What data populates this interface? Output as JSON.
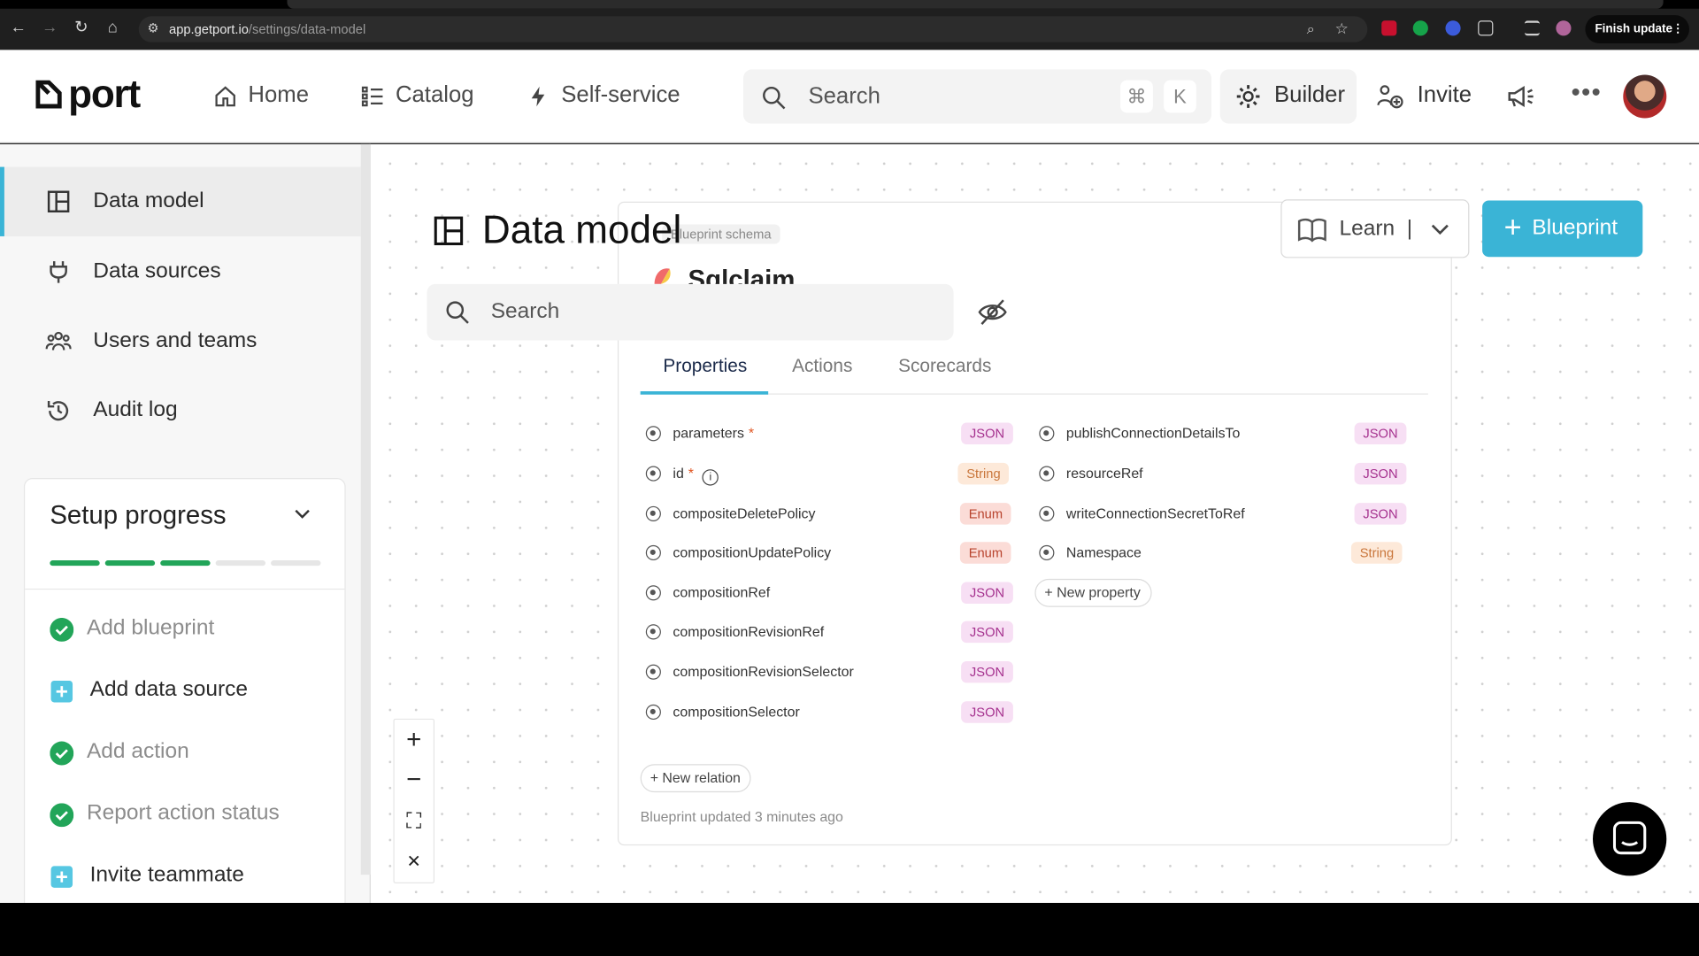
{
  "browser": {
    "url_host": "app.getport.io",
    "url_path": "/settings/data-model",
    "finish_update_label": "Finish update"
  },
  "header": {
    "logo_text": "port",
    "nav": [
      {
        "label": "Home",
        "icon": "home-icon"
      },
      {
        "label": "Catalog",
        "icon": "catalog-icon"
      },
      {
        "label": "Self-service",
        "icon": "lightning-icon"
      }
    ],
    "search_placeholder": "Search",
    "shortcut_keys": [
      "⌘",
      "K"
    ],
    "builder_label": "Builder",
    "invite_label": "Invite"
  },
  "sidebar": {
    "items": [
      {
        "label": "Data model",
        "icon": "data-model-icon",
        "active": true
      },
      {
        "label": "Data sources",
        "icon": "plug-icon",
        "active": false
      },
      {
        "label": "Users and teams",
        "icon": "users-icon",
        "active": false
      },
      {
        "label": "Audit log",
        "icon": "history-icon",
        "active": false
      }
    ],
    "setup": {
      "title": "Setup progress",
      "progress_completed": 3,
      "progress_total": 5,
      "steps": [
        {
          "label": "Add blueprint",
          "done": true
        },
        {
          "label": "Add data source",
          "done": false
        },
        {
          "label": "Add action",
          "done": true
        },
        {
          "label": "Report action status",
          "done": true
        },
        {
          "label": "Invite teammate",
          "done": false
        }
      ]
    }
  },
  "page": {
    "title": "Data model",
    "search_placeholder": "Search",
    "learn_label": "Learn",
    "learn_separator": "|",
    "add_blueprint_label": "Blueprint"
  },
  "blueprint_card": {
    "schema_tag": "Blueprint schema",
    "name": "Sqlclaim",
    "tabs": [
      "Properties",
      "Actions",
      "Scorecards"
    ],
    "active_tab": "Properties",
    "properties_left": [
      {
        "name": "parameters",
        "required": true,
        "info": false,
        "type": "JSON"
      },
      {
        "name": "id",
        "required": true,
        "info": true,
        "type": "String"
      },
      {
        "name": "compositeDeletePolicy",
        "required": false,
        "info": false,
        "type": "Enum"
      },
      {
        "name": "compositionUpdatePolicy",
        "required": false,
        "info": false,
        "type": "Enum"
      },
      {
        "name": "compositionRef",
        "required": false,
        "info": false,
        "type": "JSON"
      },
      {
        "name": "compositionRevisionRef",
        "required": false,
        "info": false,
        "type": "JSON"
      },
      {
        "name": "compositionRevisionSelector",
        "required": false,
        "info": false,
        "type": "JSON"
      },
      {
        "name": "compositionSelector",
        "required": false,
        "info": false,
        "type": "JSON"
      }
    ],
    "properties_right": [
      {
        "name": "publishConnectionDetailsTo",
        "required": false,
        "info": false,
        "type": "JSON"
      },
      {
        "name": "resourceRef",
        "required": false,
        "info": false,
        "type": "JSON"
      },
      {
        "name": "writeConnectionSecretToRef",
        "required": false,
        "info": false,
        "type": "JSON"
      },
      {
        "name": "Namespace",
        "required": false,
        "info": false,
        "type": "String"
      }
    ],
    "new_property_label": "New property",
    "new_relation_label": "New relation",
    "updated_text": "Blueprint updated 3 minutes ago"
  },
  "colors": {
    "accent": "#3ab4d6",
    "progress_done": "#22a559",
    "progress_todo": "#e6e6e6",
    "json_bg": "#f7dff4",
    "string_bg": "#fde9d9",
    "enum_bg": "#fbdcd7"
  }
}
